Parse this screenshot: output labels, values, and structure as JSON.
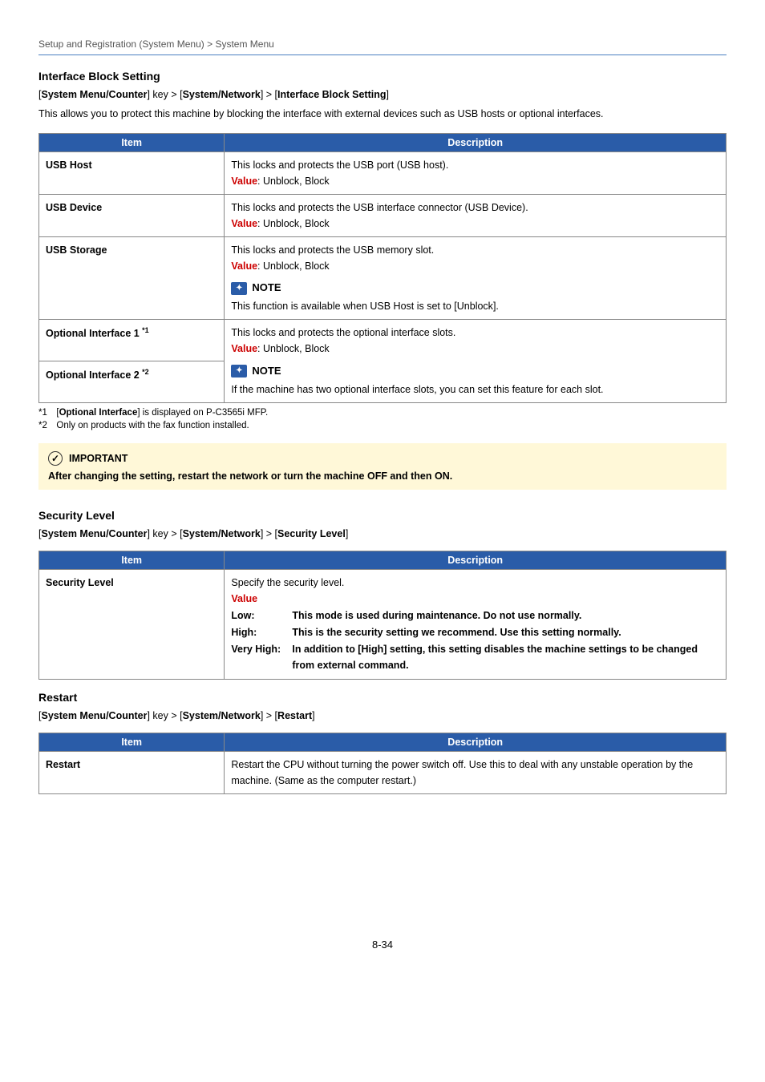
{
  "breadcrumb": "Setup and Registration (System Menu) > System Menu",
  "section1": {
    "title": "Interface Block Setting",
    "path_pre": "[",
    "path_k1": "System Menu/Counter",
    "path_mid1": "] key > [",
    "path_k2": "System/Network",
    "path_mid2": "] > [",
    "path_k3": "Interface Block Setting",
    "path_post": "]",
    "lead": "This allows you to protect this machine by blocking the interface with external devices such as USB hosts or optional interfaces.",
    "hdr_item": "Item",
    "hdr_desc": "Description",
    "valueLabel": "Value",
    "valueSep": ": ",
    "rows": {
      "usbhost": {
        "item": "USB Host",
        "desc": "This locks and protects the USB port (USB host).",
        "valueRest": "Unblock, Block"
      },
      "usbdevice": {
        "item": "USB Device",
        "desc": "This locks and protects the USB interface connector (USB Device).",
        "valueRest": "Unblock, Block"
      },
      "usbstorage": {
        "item": "USB Storage",
        "desc": "This locks and protects the USB memory slot.",
        "valueRest": "Unblock, Block",
        "noteTitle": "NOTE",
        "noteBody_a": "This function is available when USB Host is set to [",
        "noteBody_b": "Unblock",
        "noteBody_c": "]."
      },
      "opt1": {
        "item_pre": "Optional Interface 1 ",
        "item_sup": "*1"
      },
      "opt2": {
        "item_pre": "Optional Interface 2 ",
        "item_sup": "*2"
      },
      "optshared": {
        "desc": "This locks and protects the optional interface slots.",
        "valueRest": "Unblock, Block",
        "noteTitle": "NOTE",
        "noteBody": "If the machine has two optional interface slots, you can set this feature for each slot."
      }
    },
    "footnotes": {
      "f1_a": "*1 [",
      "f1_b": "Optional Interface",
      "f1_c": "] is displayed on P-C3565i MFP.",
      "f2": "*2 Only on products with the fax function installed."
    }
  },
  "important": {
    "title": "IMPORTANT",
    "body": "After changing the setting, restart the network or turn the machine OFF and then ON."
  },
  "section2": {
    "title": "Security Level",
    "path_k1": "System Menu/Counter",
    "path_k2": "System/Network",
    "path_k3": "Security Level",
    "hdr_item": "Item",
    "hdr_desc": "Description",
    "row": {
      "item": "Security Level",
      "desc": "Specify the security level.",
      "valueLabel": "Value",
      "low_t": "Low:",
      "low_d": "This mode is used during maintenance. Do not use normally.",
      "high_t": "High:",
      "high_d": "This is the security setting we recommend. Use this setting normally.",
      "vh_t": "Very High:",
      "vh_d": "In addition to [High] setting, this setting disables the machine settings to be changed from external command."
    }
  },
  "section3": {
    "title": "Restart",
    "path_k1": "System Menu/Counter",
    "path_k2": "System/Network",
    "path_k3": "Restart",
    "hdr_item": "Item",
    "hdr_desc": "Description",
    "row": {
      "item": "Restart",
      "desc": "Restart the CPU without turning the power switch off. Use this to deal with any unstable operation by the machine. (Same as the computer restart.)"
    }
  },
  "pagenum": "8-34"
}
